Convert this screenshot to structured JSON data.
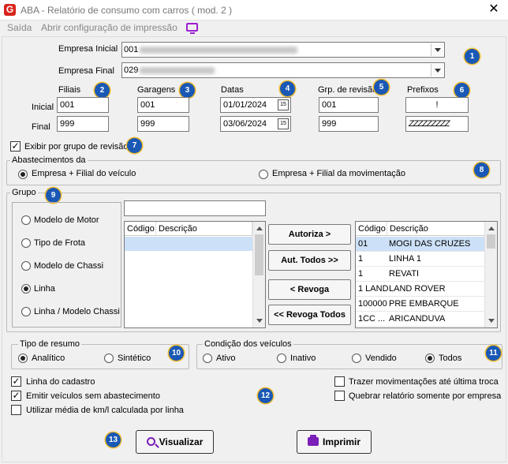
{
  "window": {
    "title": "ABA - Relatório de consumo com carros ( mod. 2 )",
    "icon_letter": "G",
    "close_glyph": "✕"
  },
  "menu": {
    "items": [
      "Saída",
      "Abrir configuração de impressão"
    ]
  },
  "empresa": {
    "inicial_label": "Empresa Inicial",
    "inicial_value": "001",
    "final_label": "Empresa Final",
    "final_value": "029"
  },
  "ranges": {
    "row_labels": {
      "inicial": "Inicial",
      "final": "Final"
    },
    "filiais": {
      "label": "Filiais",
      "inicial": "001",
      "final": "999"
    },
    "garagens": {
      "label": "Garagens",
      "inicial": "001",
      "final": "999"
    },
    "datas": {
      "label": "Datas",
      "inicial": "01/01/2024",
      "final": "03/06/2024",
      "cal_glyph": "15"
    },
    "grp_revisao": {
      "label": "Grp. de revisão",
      "inicial": "001",
      "final": "999"
    },
    "prefixos": {
      "label": "Prefixos",
      "inicial": "!",
      "final": "ZZZZZZZZZ"
    }
  },
  "badges": [
    "1",
    "2",
    "3",
    "4",
    "5",
    "6",
    "7",
    "8",
    "9",
    "10",
    "11",
    "12",
    "13"
  ],
  "exibir_grupo": {
    "label": "Exibir por grupo de revisão",
    "checked": true
  },
  "abastecimentos": {
    "title": "Abastecimentos da",
    "option1": "Empresa + Filial do veículo",
    "option2": "Empresa + Filial da movimentação",
    "selected": 1
  },
  "grupo": {
    "title": "Grupo",
    "options": [
      "Modelo de Motor",
      "Tipo de Frota",
      "Modelo de Chassi",
      "Linha",
      "Linha / Modelo Chassi"
    ],
    "selected": "Linha",
    "search_value": "",
    "left_grid": {
      "headers": [
        "Código",
        "Descrição"
      ],
      "rows": []
    },
    "buttons": {
      "autoriza": "Autoriza >",
      "aut_todos": "Aut. Todos >>",
      "revoga": "< Revoga",
      "revoga_todos": "<< Revoga Todos"
    },
    "right_grid": {
      "headers": [
        "Código",
        "Descrição"
      ],
      "rows": [
        {
          "codigo": "01",
          "descricao": "MOGI DAS CRUZES"
        },
        {
          "codigo": "1",
          "descricao": "LINHA 1"
        },
        {
          "codigo": "1",
          "descricao": "REVATI"
        },
        {
          "codigo": "1 LAND",
          "descricao": "LAND ROVER"
        },
        {
          "codigo": "100000",
          "descricao": "PRE EMBARQUE"
        },
        {
          "codigo": "1CC ...",
          "descricao": "ARICANDUVA"
        }
      ]
    }
  },
  "tipo_resumo": {
    "title": "Tipo de resumo",
    "options": [
      "Analítico",
      "Sintético"
    ],
    "selected": "Analítico"
  },
  "condicao": {
    "title": "Condição dos veículos",
    "options": [
      "Ativo",
      "Inativo",
      "Vendido",
      "Todos"
    ],
    "selected": "Todos"
  },
  "checks": {
    "linha_cadastro": {
      "label": "Linha do cadastro",
      "checked": true
    },
    "emitir_sem_abast": {
      "label": "Emitir veículos sem abastecimento",
      "checked": true
    },
    "media_km": {
      "label": "Utilizar média de km/l calculada por linha",
      "checked": false
    },
    "trazer_mov": {
      "label": "Trazer movimentações até última troca",
      "checked": false
    },
    "quebrar": {
      "label": "Quebrar relatório somente por empresa",
      "checked": false
    }
  },
  "actions": {
    "visualizar": "Visualizar",
    "imprimir": "Imprimir"
  },
  "colors": {
    "badge": "#1a58b5",
    "accent_purple": "#7a1fb8",
    "selection": "#cce0f7",
    "title_red": "#d8241c"
  }
}
